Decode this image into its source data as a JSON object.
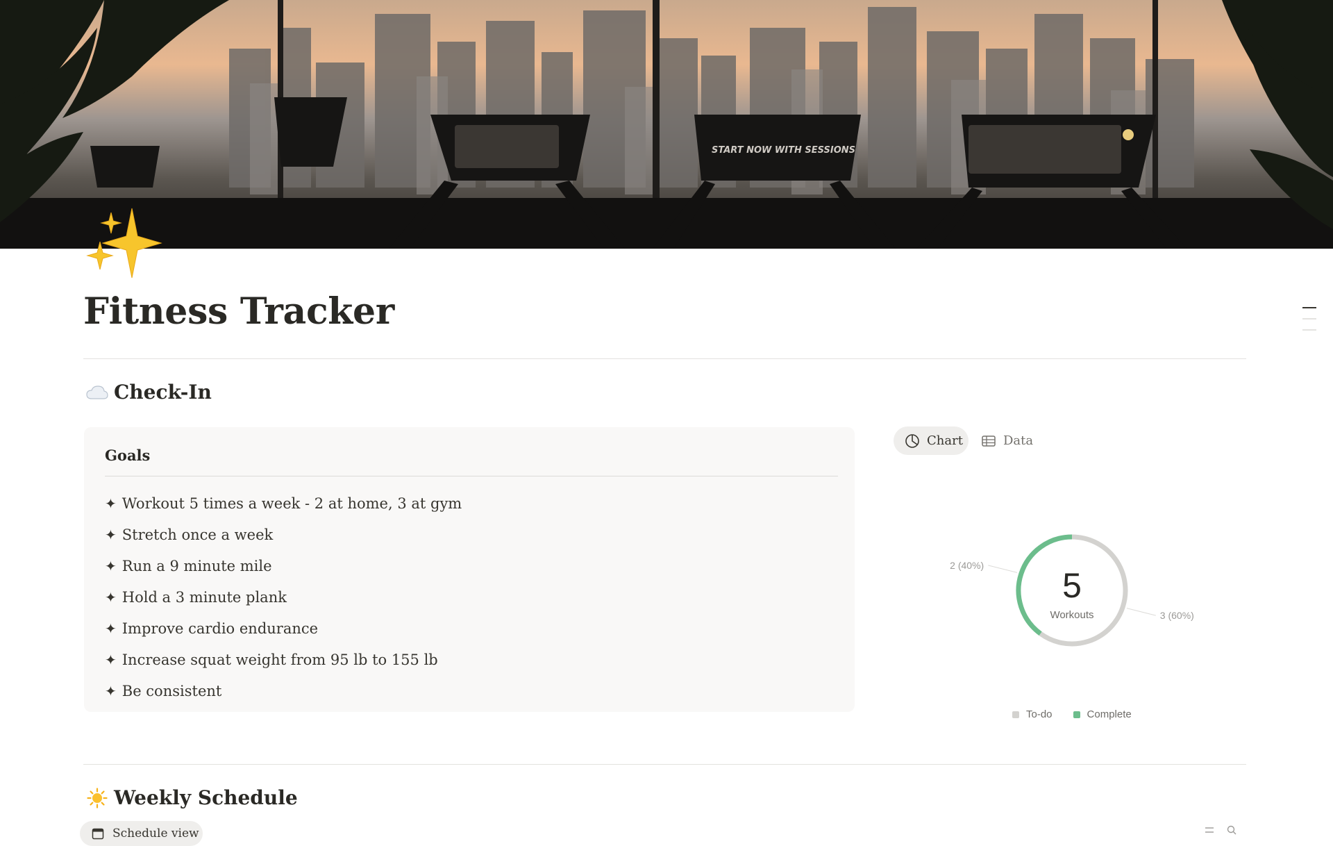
{
  "page": {
    "title": "Fitness Tracker",
    "icon": "sparkles-icon",
    "cover_description_icon": "cover-image"
  },
  "cover": {
    "screen_text": "START NOW WITH SESSIONS"
  },
  "checkin": {
    "heading": "Check-In",
    "heading_icon": "cloud-icon",
    "goals_title": "Goals",
    "goals": [
      "Workout 5 times a week - 2 at home, 3 at gym",
      "Stretch once a week",
      "Run a 9 minute mile",
      "Hold a 3 minute plank",
      "Improve cardio endurance",
      "Increase squat weight from 95 lb to 155 lb",
      "Be consistent"
    ],
    "goal_marker": "✦"
  },
  "views": {
    "chart_label": "Chart",
    "data_label": "Data",
    "chart_icon": "pie-chart-icon",
    "data_icon": "table-icon"
  },
  "chart_data": {
    "type": "pie",
    "style": "donut",
    "center_value": "5",
    "center_label": "Workouts",
    "slices": [
      {
        "name": "Complete",
        "value": 2,
        "label": "2 (40%)",
        "color": "#6cbd8c"
      },
      {
        "name": "To-do",
        "value": 3,
        "label": "3 (60%)",
        "color": "#d3d2cf"
      }
    ],
    "legend": [
      "To-do",
      "Complete"
    ],
    "legend_placement": "bottom-center"
  },
  "schedule": {
    "heading": "Weekly Schedule",
    "heading_icon": "sun-icon",
    "tab_label": "Schedule view"
  },
  "colors": {
    "accent_green": "#6cbd8c",
    "todo_gray": "#d3d2cf",
    "text": "#37352f"
  }
}
